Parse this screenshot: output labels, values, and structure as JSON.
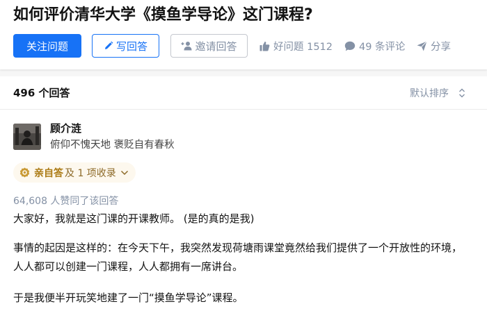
{
  "question": {
    "title": "如何评价清华大学《摸鱼学导论》这门课程?",
    "follow_label": "关注问题",
    "write_label": "写回答",
    "invite_label": "邀请回答",
    "upvote_label": "好问题 1512",
    "comment_label": "49 条评论",
    "share_label": "分享",
    "icons": {
      "write": "pencil-icon",
      "invite": "add-person-icon",
      "upvote": "thumbs-up-icon",
      "comment": "comment-bubble-icon",
      "share": "paper-plane-icon"
    }
  },
  "answers": {
    "count_label": "496 个回答",
    "sort_label": "默认排序",
    "sort_icon": "sort-arrows-icon"
  },
  "answer": {
    "author_name": "顾介涟",
    "author_bio": "俯仰不愧天地 褒贬自有春秋",
    "badge_main": "亲自答",
    "badge_sub": "及 1 项收录",
    "badge_icon": "medal-icon",
    "votes_label": "64,608 人赞同了该回答",
    "paragraphs": [
      "大家好，我就是这门课的开课教师。  (是的真的是我)",
      "事情的起因是这样的：在今天下午，我突然发现荷塘雨课堂竟然给我们提供了一个开放性的环境，",
      "人人都可以创建一门课程，人人都拥有一席讲台。",
      "于是我便半开玩笑地建了一门“摸鱼学导论”课程。"
    ]
  },
  "colors": {
    "primary": "#1772f6",
    "muted": "#8491a5",
    "badge_bg": "#fdf8ee",
    "badge_text": "#ab7a13"
  }
}
